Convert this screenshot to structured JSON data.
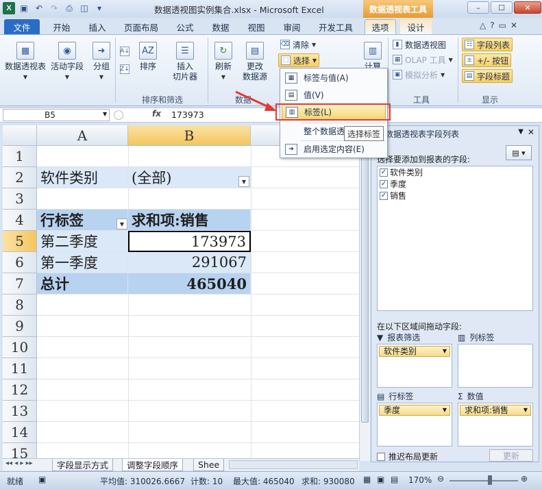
{
  "window": {
    "title": "数据透视图实例集合.xlsx - Microsoft Excel",
    "context_tools": "数据透视表工具",
    "buttons": [
      "–",
      "☐",
      "✕"
    ]
  },
  "tabs": [
    "文件",
    "开始",
    "插入",
    "页面布局",
    "公式",
    "数据",
    "视图",
    "审阅",
    "开发工具",
    "选项",
    "设计"
  ],
  "ribbon": {
    "pivot_table": "数据透视表",
    "active_field": "活动字段",
    "group": "分组",
    "sort": "排序",
    "insert_slicer_1": "插入",
    "insert_slicer_2": "切片器",
    "refresh": "刷新",
    "change_source_1": "更改",
    "change_source_2": "数据源",
    "clear": "清除",
    "select": "选择",
    "calculate": "计算",
    "group_sort_filter": "排序和筛选",
    "group_data": "数据",
    "pivot_chart": "数据透视图",
    "olap_tools": "OLAP 工具",
    "what_if": "模拟分析",
    "group_tools": "工具",
    "field_list": "字段列表",
    "plus_minus": "+/- 按钮",
    "field_headers": "字段标题",
    "group_show": "显示"
  },
  "select_menu": {
    "items": [
      "标签与值(A)",
      "值(V)",
      "标签(L)",
      "整个数据透视表(T)",
      "启用选定内容(E)"
    ],
    "tooltip": "选择标签"
  },
  "formula_bar": {
    "name_box": "B5",
    "fx": "fx",
    "value": "173973"
  },
  "sheet": {
    "columns": [
      "A",
      "B"
    ],
    "rows": [
      "1",
      "2",
      "3",
      "4",
      "5",
      "6",
      "7",
      "8",
      "9",
      "10",
      "11",
      "12",
      "13",
      "14",
      "15"
    ],
    "filter_label": "软件类别",
    "filter_value": "(全部)",
    "row_labels_header": "行标签",
    "sum_header": "求和项:销售",
    "r5_label": "第二季度",
    "r5_value": "173973",
    "r6_label": "第一季度",
    "r6_value": "291067",
    "total_label": "总计",
    "total_value": "465040"
  },
  "sheet_tabs": [
    "字段显示方式",
    "调整字段顺序",
    "Shee"
  ],
  "status": {
    "ready": "就绪",
    "average": "平均值: 310026.6667",
    "count": "计数: 10",
    "max": "最大值: 465040",
    "sum": "求和: 930080",
    "zoom": "170%"
  },
  "field_pane": {
    "title": "数据透视表字段列表",
    "choose_label": "选择要添加到报表的字段:",
    "fields": [
      "软件类别",
      "季度",
      "销售"
    ],
    "drag_label": "在以下区域间拖动字段:",
    "report_filter": "报表筛选",
    "column_labels": "列标签",
    "row_labels": "行标签",
    "values": "数值",
    "filter_chip": "软件类别",
    "row_chip": "季度",
    "value_chip": "求和项:销售",
    "defer_update": "推迟布局更新",
    "update_button": "更新"
  }
}
